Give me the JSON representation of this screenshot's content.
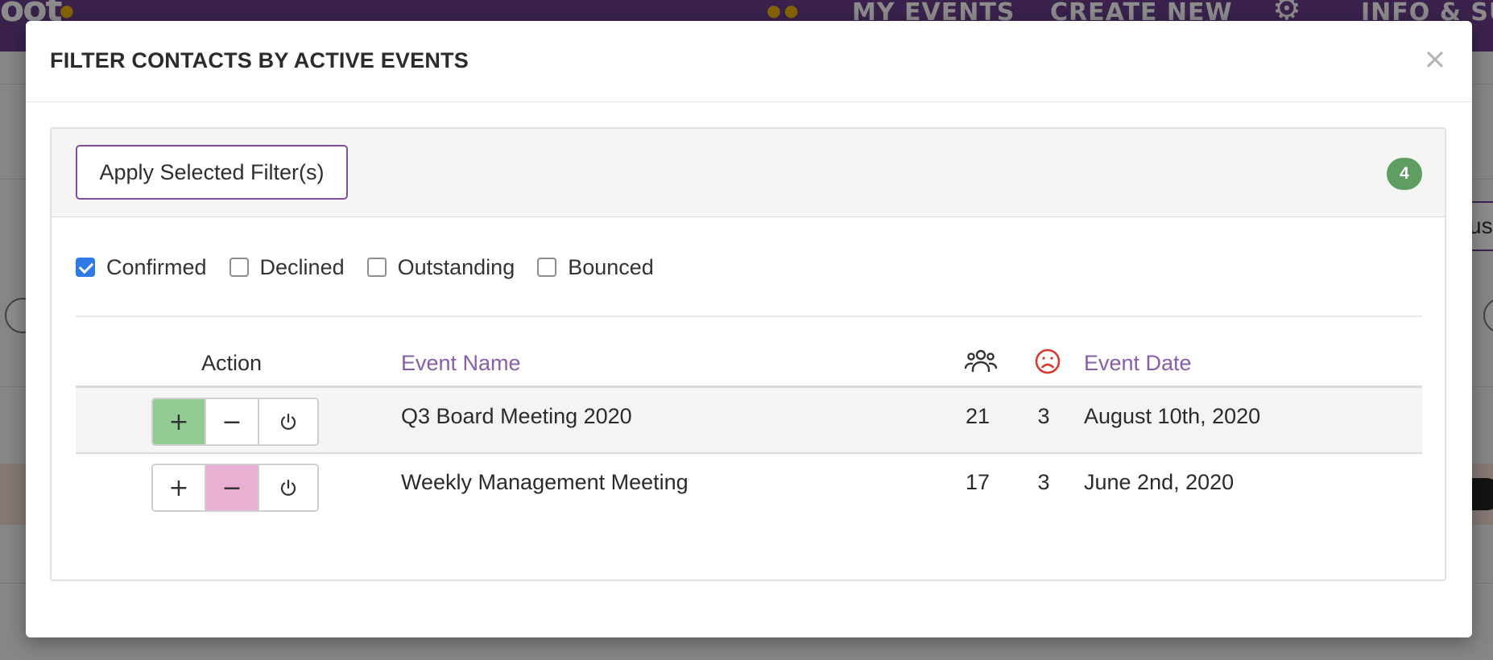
{
  "background": {
    "logo_text": "oot",
    "nav": {
      "my_events": "MY EVENTS",
      "create_new": "CREATE NEW",
      "info": "INFO & SU"
    },
    "right_button_text": "us",
    "chip_text": "t"
  },
  "modal": {
    "title": "FILTER CONTACTS BY ACTIVE EVENTS",
    "close_label": "×",
    "apply_label": "Apply Selected Filter(s)",
    "count_badge": "4",
    "statuses": [
      {
        "label": "Confirmed",
        "checked": true
      },
      {
        "label": "Declined",
        "checked": false
      },
      {
        "label": "Outstanding",
        "checked": false
      },
      {
        "label": "Bounced",
        "checked": false
      }
    ],
    "table": {
      "headers": {
        "action": "Action",
        "event_name": "Event Name",
        "event_date": "Event Date"
      },
      "rows": [
        {
          "name": "Q3 Board Meeting 2020",
          "attendees": "21",
          "declined": "3",
          "date": "August 10th, 2020",
          "active": "include"
        },
        {
          "name": "Weekly Management Meeting",
          "attendees": "17",
          "declined": "3",
          "date": "June 2nd, 2020",
          "active": "exclude"
        }
      ],
      "action_buttons": {
        "include": "+",
        "exclude": "−"
      }
    }
  },
  "colors": {
    "brand_purple": "#6b3f8c",
    "link_purple": "#8b5da8",
    "badge_green": "#5e9e62",
    "include_green": "#92cc94",
    "exclude_pink": "#e8b0d3",
    "sad_red": "#d9392c",
    "checkbox_blue": "#2f7ae5"
  },
  "icons": {
    "people": "people-group-icon",
    "sad": "sad-face-icon",
    "power": "power-icon",
    "gear": "gear-icon",
    "close": "close-icon"
  }
}
